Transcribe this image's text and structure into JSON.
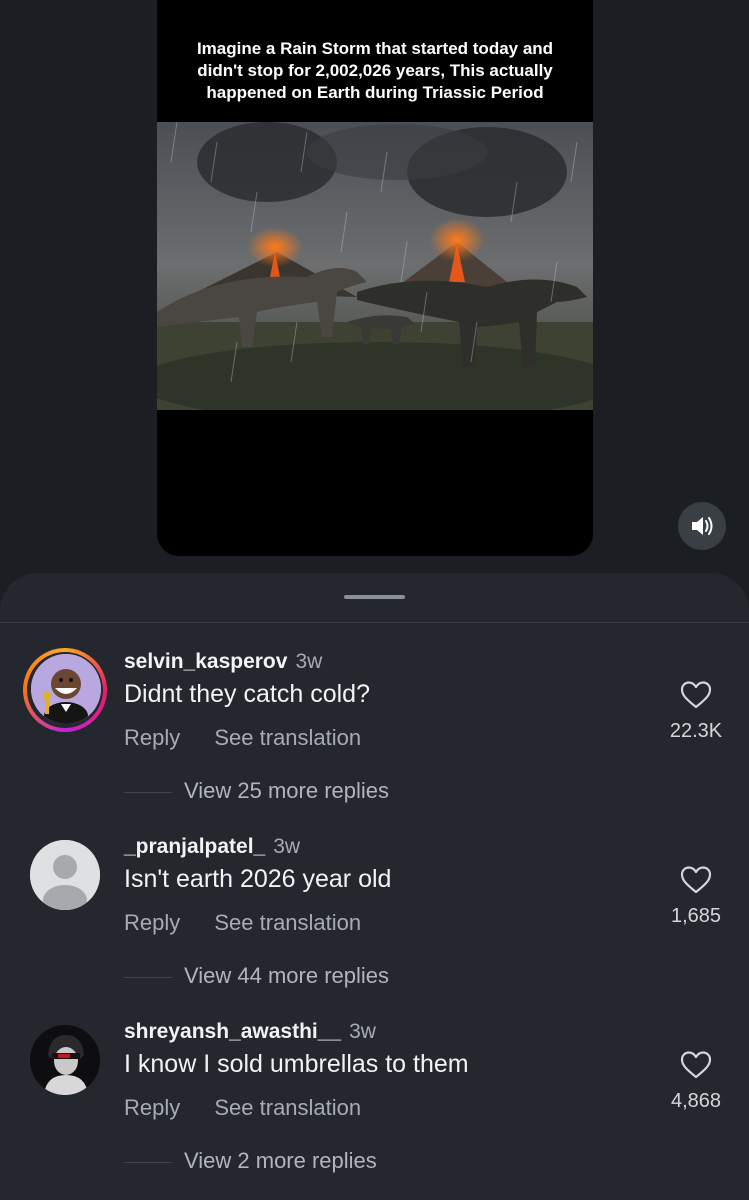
{
  "reel": {
    "caption": "Imagine a Rain Storm that started today and didn't stop for 2,002,026 years, This actually happened on Earth during Triassic Period",
    "mute_icon": "speaker-icon"
  },
  "comments": [
    {
      "username": "selvin_kasperov",
      "time": "3w",
      "text": "Didnt they catch cold?",
      "reply_label": "Reply",
      "translate_label": "See translation",
      "likes": "22.3K",
      "view_replies": "View 25 more replies"
    },
    {
      "username": "_pranjalpatel_",
      "time": "3w",
      "text": "Isn't earth 2026 year old",
      "reply_label": "Reply",
      "translate_label": "See translation",
      "likes": "1,685",
      "view_replies": "View 44 more replies"
    },
    {
      "username": "shreyansh_awasthi__",
      "time": "3w",
      "text": "I know I sold umbrellas to them",
      "reply_label": "Reply",
      "translate_label": "See translation",
      "likes": "4,868",
      "view_replies": "View 2 more replies"
    }
  ]
}
